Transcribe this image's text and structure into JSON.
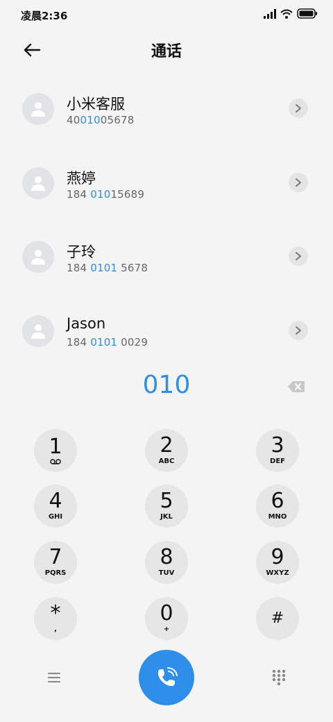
{
  "status_bar": {
    "time": "凌晨2:36",
    "icons": [
      "signal-icon",
      "wifi-icon",
      "battery-icon"
    ]
  },
  "header": {
    "title": "通话",
    "back_icon": "back-arrow-icon"
  },
  "contacts": [
    {
      "name": "小米客服",
      "number_parts": [
        "40",
        "010",
        "05678"
      ]
    },
    {
      "name": "燕婷",
      "number_parts": [
        "184 ",
        "010",
        "15689"
      ]
    },
    {
      "name": "子玲",
      "number_parts": [
        "184 ",
        "0101",
        " 5678"
      ]
    },
    {
      "name": "Jason",
      "number_parts": [
        "184 ",
        "0101",
        " 0029"
      ]
    }
  ],
  "dialer": {
    "input": "010",
    "backspace_icon": "backspace-icon"
  },
  "keypad": [
    {
      "digit": "1",
      "letters": "",
      "sub_icon": "voicemail-icon"
    },
    {
      "digit": "2",
      "letters": "ABC"
    },
    {
      "digit": "3",
      "letters": "DEF"
    },
    {
      "digit": "4",
      "letters": "GHI"
    },
    {
      "digit": "5",
      "letters": "JKL"
    },
    {
      "digit": "6",
      "letters": "MNO"
    },
    {
      "digit": "7",
      "letters": "PQRS"
    },
    {
      "digit": "8",
      "letters": "TUV"
    },
    {
      "digit": "9",
      "letters": "WXYZ"
    },
    {
      "digit": "*",
      "letters": ","
    },
    {
      "digit": "0",
      "letters": "+"
    },
    {
      "digit": "#",
      "letters": ""
    }
  ],
  "bottom_bar": {
    "menu_icon": "menu-icon",
    "call_icon": "phone-call-icon",
    "keypad_icon": "dialpad-icon"
  },
  "colors": {
    "accent": "#2f8eea",
    "background": "#f4f4f4",
    "key_background": "#e6e6e6",
    "avatar_background": "#e2e3e7"
  }
}
